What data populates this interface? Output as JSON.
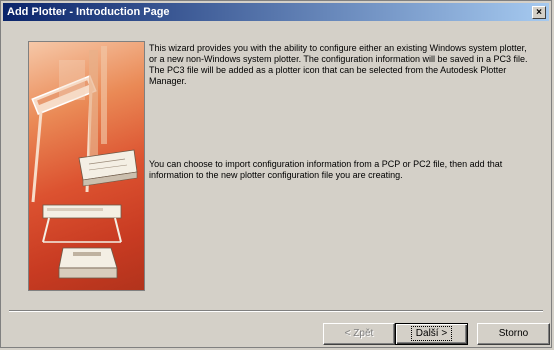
{
  "window": {
    "title": "Add Plotter - Introduction Page",
    "close_glyph": "×"
  },
  "content": {
    "intro_paragraph": "This wizard provides you with the ability to configure either an existing Windows system plotter, or a new non-Windows system plotter. The configuration information will be saved in a PC3 file. The PC3 file will be added as a plotter icon that can be selected from the Autodesk Plotter Manager.",
    "import_paragraph": "You can choose to import configuration information from a PCP or PC2 file, then add that information to the new plotter configuration file you are creating."
  },
  "buttons": {
    "back": "< Zpět",
    "next": "Další >",
    "cancel": "Storno"
  },
  "illustration": {
    "name": "plotter-illustration",
    "colors": {
      "top": "#f6c8a8",
      "bottom": "#b2331c"
    }
  }
}
